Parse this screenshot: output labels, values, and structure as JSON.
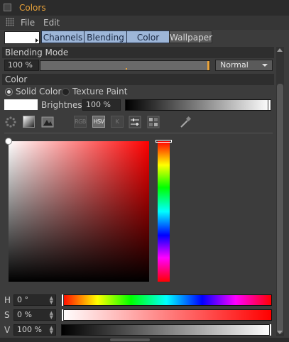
{
  "window": {
    "title": "Colors"
  },
  "menu": {
    "file": "File",
    "edit": "Edit"
  },
  "tabs": [
    {
      "label": "Channels"
    },
    {
      "label": "Blending"
    },
    {
      "label": "Color"
    },
    {
      "label": "Wallpaper"
    }
  ],
  "blending": {
    "header": "Blending Mode",
    "opacity": "100 %",
    "mode": "Normal"
  },
  "color": {
    "header": "Color",
    "solid_label": "Solid Color",
    "texture_label": "Texture Paint",
    "brightness_label": "Brightness",
    "brightness_value": "100 %",
    "swatch_color": "#ffffff",
    "modes": [
      "RGB",
      "HSV",
      "K"
    ],
    "active_mode": "HSV"
  },
  "hsv": {
    "h_label": "H",
    "h_value": "0 °",
    "s_label": "S",
    "s_value": "0 %",
    "v_label": "V",
    "v_value": "100 %"
  },
  "accent_colors": {
    "title": "#e8a23a",
    "tab_active": "#9db6d8"
  }
}
